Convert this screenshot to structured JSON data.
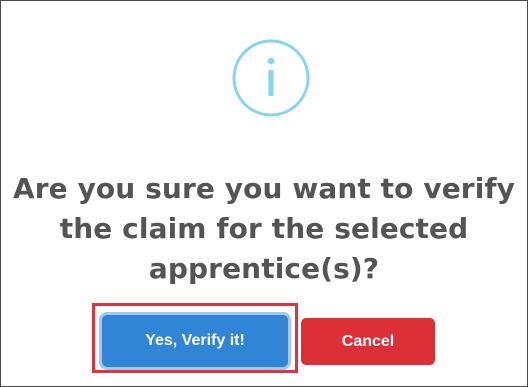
{
  "dialog": {
    "icon": "info-icon",
    "title_lines": [
      "Are you sure you want to verify",
      "the claim for the selected",
      "apprentice(s)?"
    ],
    "confirm_label": "Yes, Verify it!",
    "cancel_label": "Cancel"
  },
  "colors": {
    "icon": "#87d4ef",
    "title_text": "#545454",
    "confirm_bg": "#3085d6",
    "cancel_bg": "#dc3036",
    "highlight": "#e2323f"
  }
}
